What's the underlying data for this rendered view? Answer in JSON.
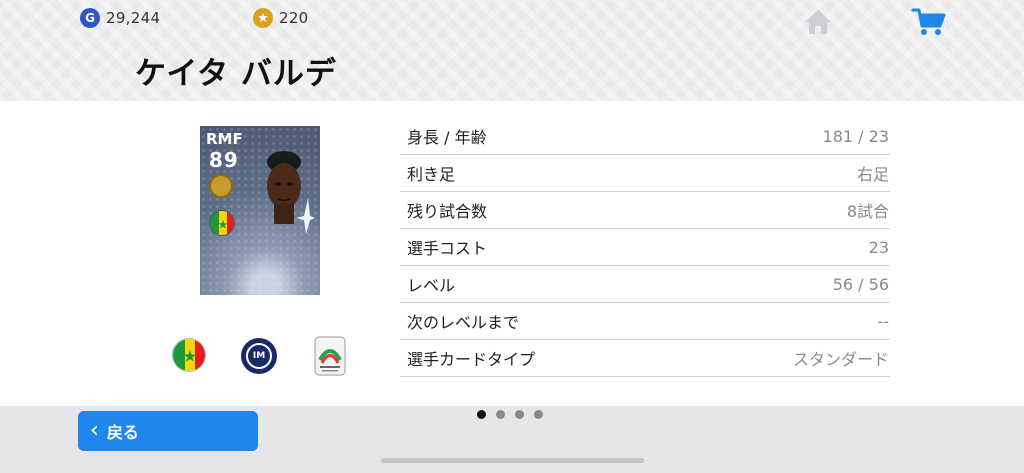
{
  "header": {
    "gp_amount": "29,244",
    "coin_amount": "220",
    "player_name": "ケイタ バルデ",
    "icons": [
      "gp-coin-icon",
      "star-coin-icon",
      "home-icon",
      "cart-icon"
    ]
  },
  "card": {
    "position": "RMF",
    "rating": "89",
    "nationality_flag": "senegal-flag-icon",
    "club": "inter-logo",
    "league": "campionato-italiano-logo"
  },
  "stats": [
    {
      "label": "身長 / 年齢",
      "value": "181 / 23"
    },
    {
      "label": "利き足",
      "value": "右足"
    },
    {
      "label": "残り試合数",
      "value": "8試合"
    },
    {
      "label": "選手コスト",
      "value": "23"
    },
    {
      "label": "レベル",
      "value": "56 / 56"
    },
    {
      "label": "次のレベルまで",
      "value": "--"
    },
    {
      "label": "選手カードタイプ",
      "value": "スタンダード"
    }
  ],
  "footer": {
    "back_label": "戻る",
    "page_count": 4,
    "active_page": 1
  },
  "colors": {
    "accent": "#1f86ec",
    "header_bg": "#e9e9ec",
    "gp": "#2f57c9",
    "coin": "#d8a21a"
  }
}
